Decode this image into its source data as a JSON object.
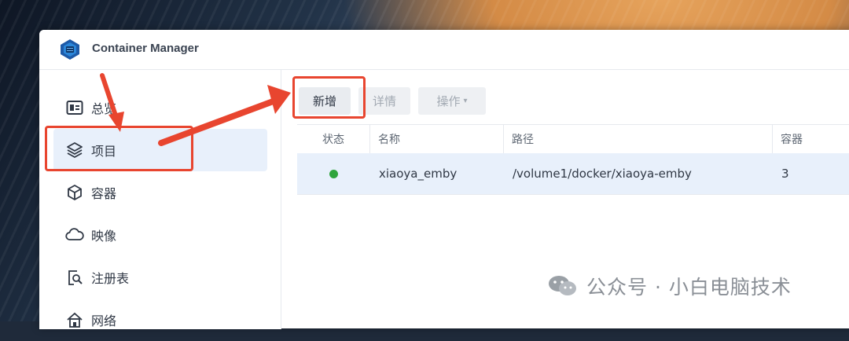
{
  "app": {
    "title": "Container Manager",
    "icon": "container-manager-icon"
  },
  "sidebar": {
    "items": [
      {
        "label": "总览",
        "icon": "overview-icon",
        "active": false
      },
      {
        "label": "项目",
        "icon": "layers-icon",
        "active": true
      },
      {
        "label": "容器",
        "icon": "cube-icon",
        "active": false
      },
      {
        "label": "映像",
        "icon": "cloud-icon",
        "active": false
      },
      {
        "label": "注册表",
        "icon": "registry-search-icon",
        "active": false
      },
      {
        "label": "网络",
        "icon": "home-network-icon",
        "active": false
      }
    ]
  },
  "toolbar": {
    "create_label": "新增",
    "details_label": "详情",
    "actions_label": "操作",
    "actions_caret": "▾"
  },
  "table": {
    "columns": [
      "状态",
      "名称",
      "路径",
      "容器"
    ],
    "rows": [
      {
        "status": "running",
        "name": "xiaoya_emby",
        "path": "/volume1/docker/xiaoya-emby",
        "containers": "3"
      }
    ]
  },
  "watermark": {
    "text": "公众号 · 小白电脑技术",
    "icon": "wechat-icon"
  },
  "colors": {
    "accent_red": "#e8452f",
    "status_green": "#2fa43c",
    "selection_blue": "#e8f0fb"
  }
}
